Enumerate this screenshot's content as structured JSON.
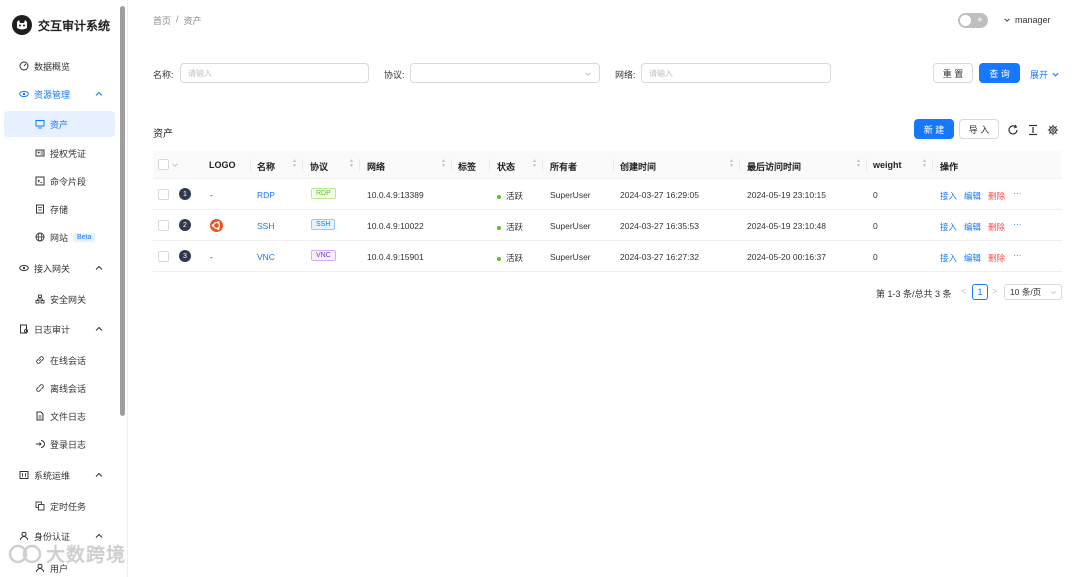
{
  "app": {
    "title": "交互审计系统"
  },
  "sidebar": {
    "items": [
      {
        "label": "数据概览"
      },
      {
        "label": "资源管理"
      },
      {
        "label": "资产"
      },
      {
        "label": "授权凭证"
      },
      {
        "label": "命令片段"
      },
      {
        "label": "存储"
      },
      {
        "label": "网站",
        "badge": "Beta"
      },
      {
        "label": "接入网关"
      },
      {
        "label": "安全网关"
      },
      {
        "label": "日志审计"
      },
      {
        "label": "在线会话"
      },
      {
        "label": "离线会话"
      },
      {
        "label": "文件日志"
      },
      {
        "label": "登录日志"
      },
      {
        "label": "系统运维"
      },
      {
        "label": "定时任务"
      },
      {
        "label": "身份认证"
      },
      {
        "label": "用户"
      }
    ]
  },
  "watermark": {
    "text": "大数跨境"
  },
  "header": {
    "breadcrumb": [
      "首页",
      "/",
      "资产"
    ],
    "user": "manager"
  },
  "search": {
    "name_label": "名称:",
    "name_placeholder": "请输入",
    "protocol_label": "协议:",
    "network_label": "网络:",
    "network_placeholder": "请输入",
    "reset": "重 置",
    "query": "查 询",
    "expand": "展开"
  },
  "table_card": {
    "title": "资产",
    "new_button": "新 建",
    "import_button": "导 入"
  },
  "table": {
    "columns": [
      "LOGO",
      "名称",
      "协议",
      "网络",
      "标签",
      "状态",
      "所有者",
      "创建时间",
      "最后访问时间",
      "weight",
      "操作"
    ],
    "rows": [
      {
        "index": "1",
        "logo": "-",
        "name": "RDP",
        "protocol": "RDP",
        "network": "10.0.4.9:13389",
        "tags": "",
        "status": "活跃",
        "owner": "SuperUser",
        "created": "2024-03-27 16:29:05",
        "last_access": "2024-05-19 23:10:15",
        "weight": "0"
      },
      {
        "index": "2",
        "logo": "",
        "name": "SSH",
        "protocol": "SSH",
        "network": "10.0.4.9:10022",
        "tags": "",
        "status": "活跃",
        "owner": "SuperUser",
        "created": "2024-03-27 16:35:53",
        "last_access": "2024-05-19 23:10:48",
        "weight": "0"
      },
      {
        "index": "3",
        "logo": "-",
        "name": "VNC",
        "protocol": "VNC",
        "network": "10.0.4.9:15901",
        "tags": "",
        "status": "活跃",
        "owner": "SuperUser",
        "created": "2024-03-27 16:27:32",
        "last_access": "2024-05-20 00:16:37",
        "weight": "0"
      }
    ],
    "actions": {
      "connect": "接入",
      "edit": "编辑",
      "delete": "删除",
      "more": "···"
    }
  },
  "pagination": {
    "total_text": "第 1-3 条/总共 3 条",
    "prev": "<",
    "current": "1",
    "next": ">",
    "page_size": "10 条/页"
  },
  "colors": {
    "primary": "#1677ff",
    "danger": "#ff4d4f",
    "success": "#52c41a",
    "sidebar_active_bg": "#e6f0ff"
  }
}
